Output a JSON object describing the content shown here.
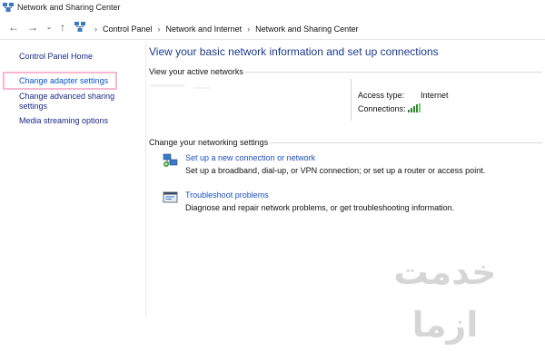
{
  "window": {
    "title": "Network and Sharing Center"
  },
  "nav": {
    "back_icon": "arrow-left-icon",
    "forward_icon": "arrow-right-icon",
    "recent_icon": "chevron-down-icon",
    "up_icon": "arrow-up-icon"
  },
  "breadcrumb": {
    "items": [
      "Control Panel",
      "Network and Internet",
      "Network and Sharing Center"
    ],
    "separator": "›"
  },
  "sidebar": {
    "items": [
      {
        "label": "Control Panel Home"
      },
      {
        "label": "Change adapter settings"
      },
      {
        "label": "Change advanced sharing settings",
        "line1": "Change advanced sharing",
        "line2": "settings"
      },
      {
        "label": "Media streaming options"
      }
    ]
  },
  "main": {
    "title": "View your basic network information and set up connections",
    "active_networks_heading": "View your active networks",
    "access_type_label": "Access type:",
    "access_type_value": "Internet",
    "connections_label": "Connections:",
    "change_settings_heading": "Change your networking settings",
    "tasks": [
      {
        "link": "Set up a new connection or network",
        "desc": "Set up a broadband, dial-up, or VPN connection; or set up a router or access point.",
        "icon": "new-connection-icon"
      },
      {
        "link": "Troubleshoot problems",
        "desc": "Diagnose and repair network problems, or get troubleshooting information.",
        "icon": "troubleshoot-icon"
      }
    ]
  },
  "watermark": {
    "text": "خدمت ازما"
  },
  "colors": {
    "link": "#1a4fc0",
    "title": "#1b3a8b",
    "highlight": "#f7b7d2"
  }
}
